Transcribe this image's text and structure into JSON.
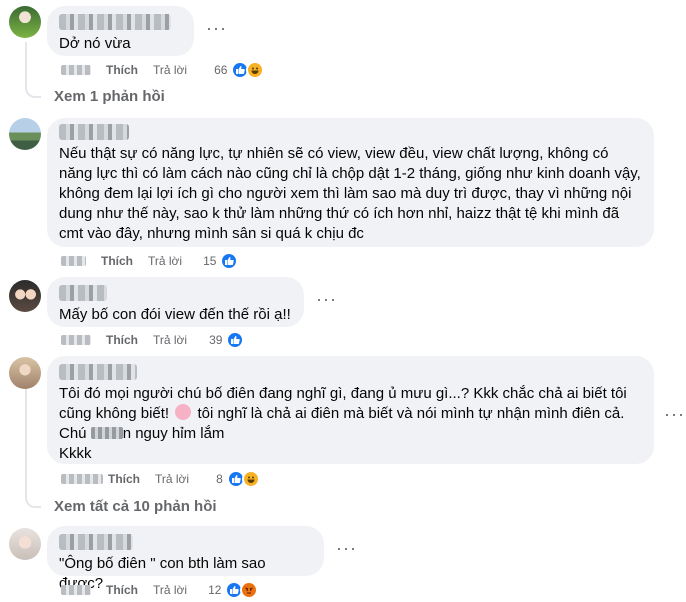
{
  "comments": [
    {
      "text": "Dở nó vừa",
      "like_label": "Thích",
      "reply_label": "Trả lời",
      "reaction_count": "66",
      "reactions": [
        "like",
        "haha"
      ]
    },
    {
      "text": "Nếu thật sự có năng lực, tự nhiên sẽ có view, view đều, view chất lượng, không có năng lực thì có làm cách nào cũng chỉ là chộp dật 1-2 tháng, giống như kinh doanh vậy, không đem lại lợi ích gì cho người xem thì làm sao mà duy trì được, thay vì những nội dung như thế này, sao k thử làm những thứ có ích hơn nhỉ, haizz thật tệ khi mình đã cmt vào đây, nhưng mình sân si quá k chịu đc",
      "like_label": "Thích",
      "reply_label": "Trả lời",
      "reaction_count": "15",
      "reactions": [
        "like"
      ]
    },
    {
      "text": "Mấy bố con đói view đến thế rồi ạ!!",
      "like_label": "Thích",
      "reply_label": "Trả lời",
      "reaction_count": "39",
      "reactions": [
        "like"
      ]
    },
    {
      "text_part1": "Tôi đó mọi người chú bố điên đang nghĩ gì, đang ủ mưu gì...? Kkk chắc chả ai biết tôi cũng không biết!",
      "text_part2": "tôi nghĩ là chả ai điên mà biết và nói mình tự nhận mình điên cả.",
      "text_part3a": "Chú",
      "text_part3b": "n nguy hỉm lắm",
      "text_part4": "Kkkk",
      "like_label": "Thích",
      "reply_label": "Trả lời",
      "reaction_count": "8",
      "reactions": [
        "like",
        "haha"
      ]
    },
    {
      "text": "\"Ông bố điên \" con bth làm sao được?",
      "like_label": "Thích",
      "reply_label": "Trả lời",
      "reaction_count": "12",
      "reactions": [
        "like",
        "angry"
      ]
    }
  ],
  "view_replies_1": "Xem 1 phản hồi",
  "view_replies_2": "Xem tất cả 10 phản hồi",
  "more_label": "···",
  "colors": {
    "bubble": "#f0f2f5",
    "muted": "#65676b",
    "like": "#1877f2"
  }
}
